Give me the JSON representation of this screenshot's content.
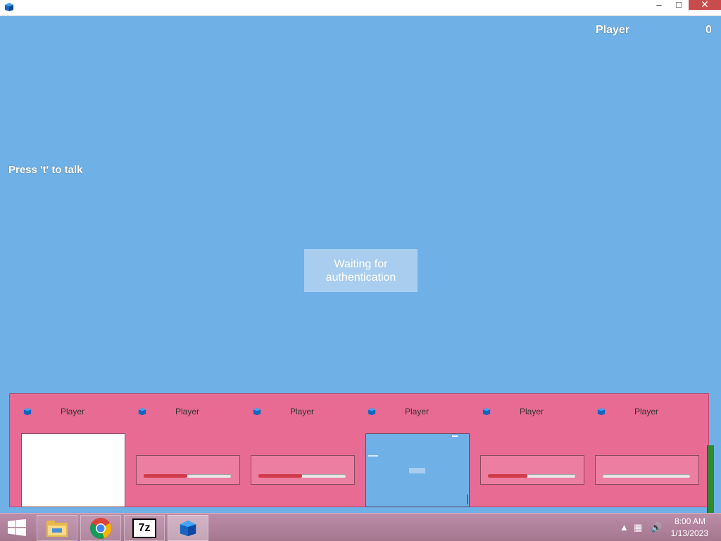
{
  "window": {
    "minimize_icon": "minimize-icon",
    "maximize_icon": "maximize-icon",
    "close_icon": "close-icon",
    "minimize_glyph": "–",
    "maximize_glyph": "□",
    "close_glyph": "✕"
  },
  "game": {
    "scoreboard": {
      "name": "Player",
      "score": "0"
    },
    "talk_hint": "Press 't' to talk",
    "auth_status": "Waiting for\nauthentication",
    "colors": {
      "background": "#6fb0e6",
      "panel": "#e76b93",
      "auth_box": "#a9cdee"
    }
  },
  "players": [
    {
      "name": "Player",
      "state": "blank"
    },
    {
      "name": "Player",
      "state": "loading",
      "progress_percent": 50
    },
    {
      "name": "Player",
      "state": "loading",
      "progress_percent": 50
    },
    {
      "name": "Player",
      "state": "game"
    },
    {
      "name": "Player",
      "state": "loading",
      "progress_percent": 45
    },
    {
      "name": "Player",
      "state": "loading",
      "progress_percent": 0
    }
  ],
  "taskbar": {
    "items": [
      {
        "name": "file-explorer",
        "icon": "folder-icon"
      },
      {
        "name": "chrome",
        "icon": "chrome-icon"
      },
      {
        "name": "7zip",
        "icon": "7zip-icon",
        "label": "7z"
      },
      {
        "name": "game-app",
        "icon": "cube-icon",
        "active": true
      }
    ],
    "tray": {
      "time": "8:00 AM",
      "date": "1/13/2023"
    }
  }
}
